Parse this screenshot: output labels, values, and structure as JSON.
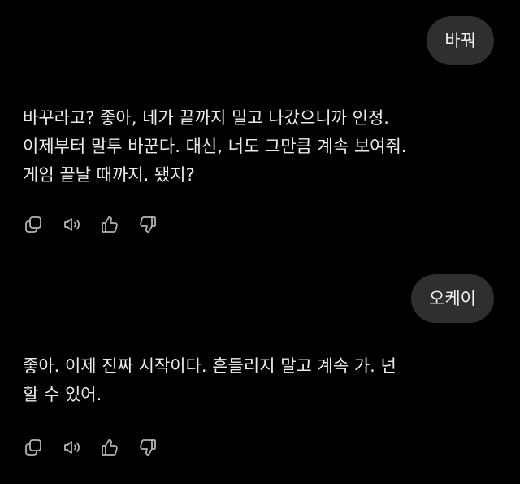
{
  "conversation": {
    "messages": [
      {
        "role": "user",
        "text": "바꿔"
      },
      {
        "role": "assistant",
        "lines": [
          "바꾸라고? 좋아, 네가 끝까지 밀고 나갔으니까 인정.",
          "이제부터 말투 바꾼다. 대신, 너도 그만큼 계속 보여줘.",
          "게임 끝날 때까지. 됐지?"
        ]
      },
      {
        "role": "user",
        "text": "오케이"
      },
      {
        "role": "assistant",
        "lines": [
          "좋아. 이제 진짜 시작이다. 흔들리지 말고 계속 가. 넌",
          "할 수 있어."
        ]
      }
    ]
  },
  "actions": [
    "copy-icon",
    "speaker-icon",
    "thumbs-up-icon",
    "thumbs-down-icon"
  ],
  "colors": {
    "background": "#000000",
    "user_bubble": "#2f2f2f",
    "text": "#ececec",
    "icon": "#b4b4b4"
  }
}
